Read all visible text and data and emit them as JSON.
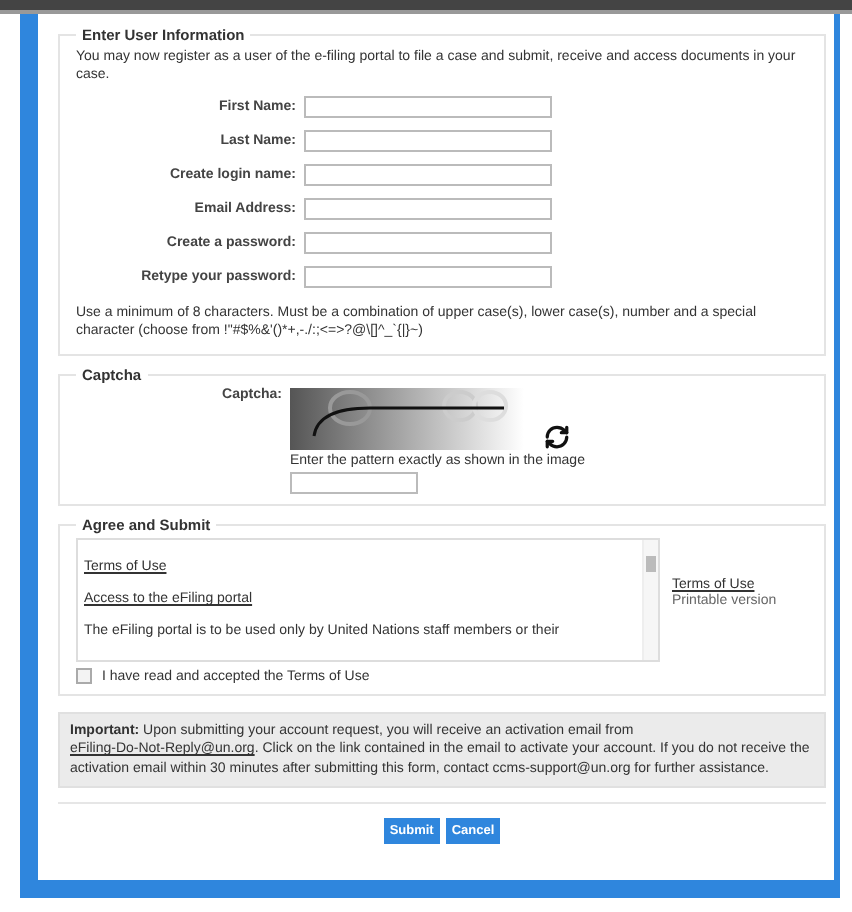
{
  "user_info": {
    "legend": "Enter User Information",
    "intro": "You may now register as a user of the e-filing portal to file a case and submit, receive and access documents in your case.",
    "fields": [
      {
        "label": "First Name:"
      },
      {
        "label": "Last Name:"
      },
      {
        "label": "Create login name:"
      },
      {
        "label": "Email Address:"
      },
      {
        "label": "Create a password:"
      },
      {
        "label": "Retype your password:"
      }
    ],
    "hint": "Use a minimum of 8 characters. Must be a combination of upper case(s), lower case(s), number and a special character (choose from !\"#$%&'()*+,-./:;<=>?@\\[]^_`{|}~)"
  },
  "captcha": {
    "legend": "Captcha",
    "label": "Captcha:",
    "instruction": "Enter the pattern exactly as shown in the image"
  },
  "agree": {
    "legend": "Agree and Submit",
    "terms_title": "Terms of Use",
    "terms_section": "Access to the eFiling portal",
    "terms_text": "The eFiling portal is to be used only by United Nations staff members or their",
    "side_link": "Terms of Use",
    "side_note": "Printable version",
    "checkbox": {
      "label": "I have read and accepted the Terms of Use",
      "checked": false
    }
  },
  "notice": {
    "before": "**Important:** Upon submitting your account request, you will receive an activation email from ",
    "link": "eFiling-Do-Not-Reply@un.org",
    "after": ". Click on the link contained in the email to activate your account. If you do not receive the activation email within 30 minutes after submitting this form, contact ccms-support@un.org for further assistance."
  },
  "buttons": [
    "Submit",
    "Cancel"
  ]
}
